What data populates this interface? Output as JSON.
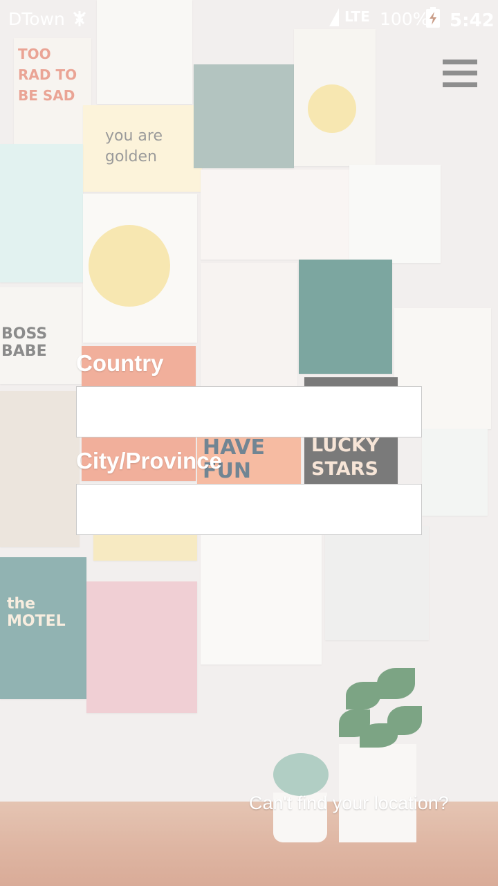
{
  "status_bar": {
    "carrier": "DTown",
    "carrier_icon": "network-tower-icon",
    "network_type": "LTE",
    "battery_percent": "100%",
    "battery_icon": "battery-charging-icon",
    "time": "5:42"
  },
  "header": {
    "menu_icon": "hamburger-menu-icon"
  },
  "form": {
    "country_label": "Country",
    "country_value": "",
    "city_label": "City/Province",
    "city_value": ""
  },
  "footer": {
    "cant_find_link": "Can't find your location?"
  },
  "background_art": {
    "too_rad": "TOO RAD TO BE SAD",
    "you_are_golden": "you are golden",
    "boss_babe": "BOSS BABE",
    "have_fun": "HAVE FUN",
    "lucky_stars": "LUCKY STARS",
    "the_motel": "the MOTEL"
  }
}
